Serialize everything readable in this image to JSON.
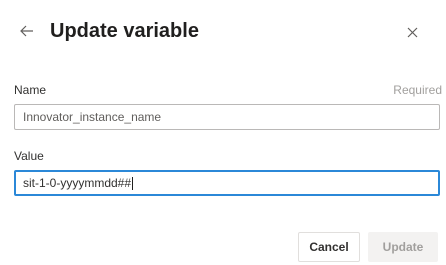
{
  "dialog": {
    "title": "Update variable",
    "back_icon": "arrow-left-icon",
    "close_icon": "close-icon"
  },
  "name_field": {
    "label": "Name",
    "required_text": "Required",
    "value": "Innovator_instance_name"
  },
  "value_field": {
    "label": "Value",
    "value": "sit-1-0-yyyymmdd##"
  },
  "buttons": {
    "cancel_label": "Cancel",
    "update_label": "Update"
  },
  "colors": {
    "focus_border": "#2b88d8",
    "text_primary": "#201f1e",
    "text_muted": "#a19f9d"
  }
}
